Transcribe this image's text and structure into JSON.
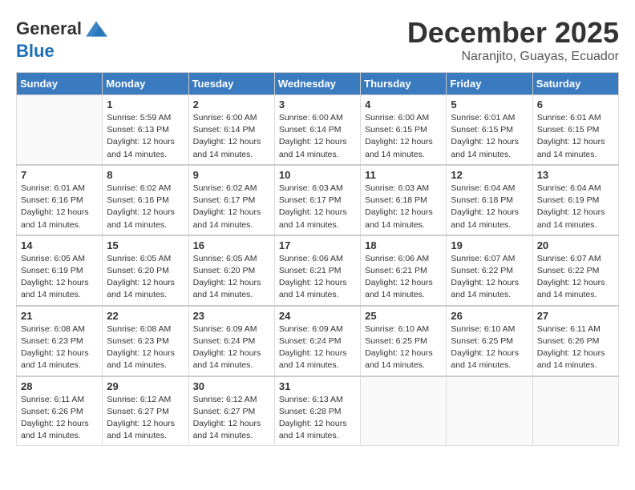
{
  "header": {
    "logo_line1": "General",
    "logo_line2": "Blue",
    "month": "December 2025",
    "location": "Naranjito, Guayas, Ecuador"
  },
  "columns": [
    "Sunday",
    "Monday",
    "Tuesday",
    "Wednesday",
    "Thursday",
    "Friday",
    "Saturday"
  ],
  "weeks": [
    [
      {
        "day": "",
        "info": ""
      },
      {
        "day": "1",
        "info": "Sunrise: 5:59 AM\nSunset: 6:13 PM\nDaylight: 12 hours\nand 14 minutes."
      },
      {
        "day": "2",
        "info": "Sunrise: 6:00 AM\nSunset: 6:14 PM\nDaylight: 12 hours\nand 14 minutes."
      },
      {
        "day": "3",
        "info": "Sunrise: 6:00 AM\nSunset: 6:14 PM\nDaylight: 12 hours\nand 14 minutes."
      },
      {
        "day": "4",
        "info": "Sunrise: 6:00 AM\nSunset: 6:15 PM\nDaylight: 12 hours\nand 14 minutes."
      },
      {
        "day": "5",
        "info": "Sunrise: 6:01 AM\nSunset: 6:15 PM\nDaylight: 12 hours\nand 14 minutes."
      },
      {
        "day": "6",
        "info": "Sunrise: 6:01 AM\nSunset: 6:15 PM\nDaylight: 12 hours\nand 14 minutes."
      }
    ],
    [
      {
        "day": "7",
        "info": "Sunrise: 6:01 AM\nSunset: 6:16 PM\nDaylight: 12 hours\nand 14 minutes."
      },
      {
        "day": "8",
        "info": "Sunrise: 6:02 AM\nSunset: 6:16 PM\nDaylight: 12 hours\nand 14 minutes."
      },
      {
        "day": "9",
        "info": "Sunrise: 6:02 AM\nSunset: 6:17 PM\nDaylight: 12 hours\nand 14 minutes."
      },
      {
        "day": "10",
        "info": "Sunrise: 6:03 AM\nSunset: 6:17 PM\nDaylight: 12 hours\nand 14 minutes."
      },
      {
        "day": "11",
        "info": "Sunrise: 6:03 AM\nSunset: 6:18 PM\nDaylight: 12 hours\nand 14 minutes."
      },
      {
        "day": "12",
        "info": "Sunrise: 6:04 AM\nSunset: 6:18 PM\nDaylight: 12 hours\nand 14 minutes."
      },
      {
        "day": "13",
        "info": "Sunrise: 6:04 AM\nSunset: 6:19 PM\nDaylight: 12 hours\nand 14 minutes."
      }
    ],
    [
      {
        "day": "14",
        "info": "Sunrise: 6:05 AM\nSunset: 6:19 PM\nDaylight: 12 hours\nand 14 minutes."
      },
      {
        "day": "15",
        "info": "Sunrise: 6:05 AM\nSunset: 6:20 PM\nDaylight: 12 hours\nand 14 minutes."
      },
      {
        "day": "16",
        "info": "Sunrise: 6:05 AM\nSunset: 6:20 PM\nDaylight: 12 hours\nand 14 minutes."
      },
      {
        "day": "17",
        "info": "Sunrise: 6:06 AM\nSunset: 6:21 PM\nDaylight: 12 hours\nand 14 minutes."
      },
      {
        "day": "18",
        "info": "Sunrise: 6:06 AM\nSunset: 6:21 PM\nDaylight: 12 hours\nand 14 minutes."
      },
      {
        "day": "19",
        "info": "Sunrise: 6:07 AM\nSunset: 6:22 PM\nDaylight: 12 hours\nand 14 minutes."
      },
      {
        "day": "20",
        "info": "Sunrise: 6:07 AM\nSunset: 6:22 PM\nDaylight: 12 hours\nand 14 minutes."
      }
    ],
    [
      {
        "day": "21",
        "info": "Sunrise: 6:08 AM\nSunset: 6:23 PM\nDaylight: 12 hours\nand 14 minutes."
      },
      {
        "day": "22",
        "info": "Sunrise: 6:08 AM\nSunset: 6:23 PM\nDaylight: 12 hours\nand 14 minutes."
      },
      {
        "day": "23",
        "info": "Sunrise: 6:09 AM\nSunset: 6:24 PM\nDaylight: 12 hours\nand 14 minutes."
      },
      {
        "day": "24",
        "info": "Sunrise: 6:09 AM\nSunset: 6:24 PM\nDaylight: 12 hours\nand 14 minutes."
      },
      {
        "day": "25",
        "info": "Sunrise: 6:10 AM\nSunset: 6:25 PM\nDaylight: 12 hours\nand 14 minutes."
      },
      {
        "day": "26",
        "info": "Sunrise: 6:10 AM\nSunset: 6:25 PM\nDaylight: 12 hours\nand 14 minutes."
      },
      {
        "day": "27",
        "info": "Sunrise: 6:11 AM\nSunset: 6:26 PM\nDaylight: 12 hours\nand 14 minutes."
      }
    ],
    [
      {
        "day": "28",
        "info": "Sunrise: 6:11 AM\nSunset: 6:26 PM\nDaylight: 12 hours\nand 14 minutes."
      },
      {
        "day": "29",
        "info": "Sunrise: 6:12 AM\nSunset: 6:27 PM\nDaylight: 12 hours\nand 14 minutes."
      },
      {
        "day": "30",
        "info": "Sunrise: 6:12 AM\nSunset: 6:27 PM\nDaylight: 12 hours\nand 14 minutes."
      },
      {
        "day": "31",
        "info": "Sunrise: 6:13 AM\nSunset: 6:28 PM\nDaylight: 12 hours\nand 14 minutes."
      },
      {
        "day": "",
        "info": ""
      },
      {
        "day": "",
        "info": ""
      },
      {
        "day": "",
        "info": ""
      }
    ]
  ]
}
